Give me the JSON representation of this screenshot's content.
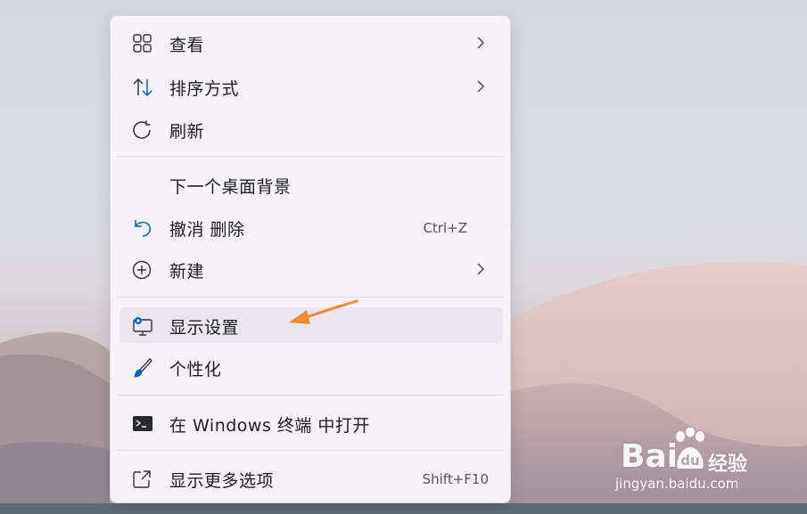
{
  "menu": {
    "items": [
      {
        "label": "查看",
        "icon": "grid-icon",
        "has_submenu": true
      },
      {
        "label": "排序方式",
        "icon": "sort-icon",
        "has_submenu": true
      },
      {
        "label": "刷新",
        "icon": "refresh-icon"
      },
      {
        "label": "下一个桌面背景"
      },
      {
        "label": "撤消 删除",
        "icon": "undo-icon",
        "shortcut": "Ctrl+Z"
      },
      {
        "label": "新建",
        "icon": "add-circle-icon",
        "has_submenu": true
      },
      {
        "label": "显示设置",
        "icon": "display-settings-icon",
        "highlighted": true
      },
      {
        "label": "个性化",
        "icon": "brush-icon"
      },
      {
        "label": "在 Windows 终端 中打开",
        "icon": "terminal-icon"
      },
      {
        "label": "显示更多选项",
        "icon": "open-external-icon",
        "shortcut": "Shift+F10"
      }
    ]
  },
  "watermark": {
    "brand": "Bai",
    "brand_suffix": "经验",
    "url": "jingyan.baidu.com"
  },
  "colors": {
    "accent": "#0067c0",
    "arrow": "#f08a2e",
    "highlight": "#e9e7ed"
  }
}
